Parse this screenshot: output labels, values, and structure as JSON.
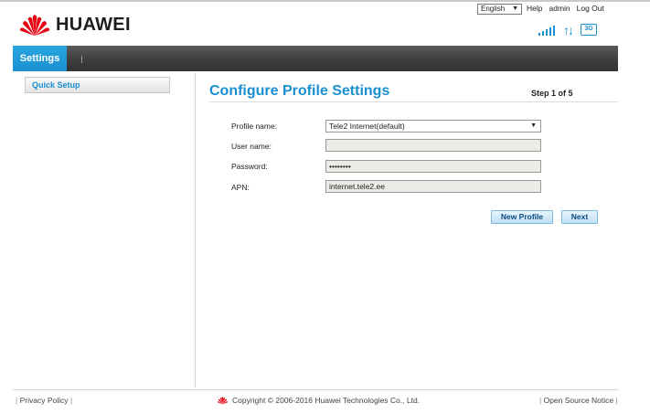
{
  "header": {
    "brand": "HUAWEI",
    "language": "English",
    "links": [
      "Help",
      "admin",
      "Log Out"
    ],
    "network_badge": "3G"
  },
  "nav": {
    "active_tab": "Settings"
  },
  "sidebar": {
    "items": [
      {
        "label": "Quick Setup"
      }
    ]
  },
  "main": {
    "title": "Configure Profile Settings",
    "step": "Step 1 of 5",
    "form": {
      "profile_name": {
        "label": "Profile name:",
        "value": "Tele2 Internet(default)"
      },
      "user_name": {
        "label": "User name:",
        "value": ""
      },
      "password": {
        "label": "Password:",
        "value": "••••••••"
      },
      "apn": {
        "label": "APN:",
        "value": "internet.tele2.ee"
      }
    },
    "buttons": {
      "new_profile": "New Profile",
      "next": "Next"
    }
  },
  "footer": {
    "privacy": "Privacy Policy",
    "copyright": "Copyright © 2006-2016 Huawei Technologies Co., Ltd.",
    "open_source": "Open Source Notice"
  },
  "colors": {
    "accent": "#1a8fd0",
    "brand_red": "#e60012",
    "navbar": "#3e3e3e"
  },
  "icons": [
    "huawei-logo-icon",
    "signal-strength-icon",
    "data-transfer-icon",
    "network-3g-icon"
  ]
}
